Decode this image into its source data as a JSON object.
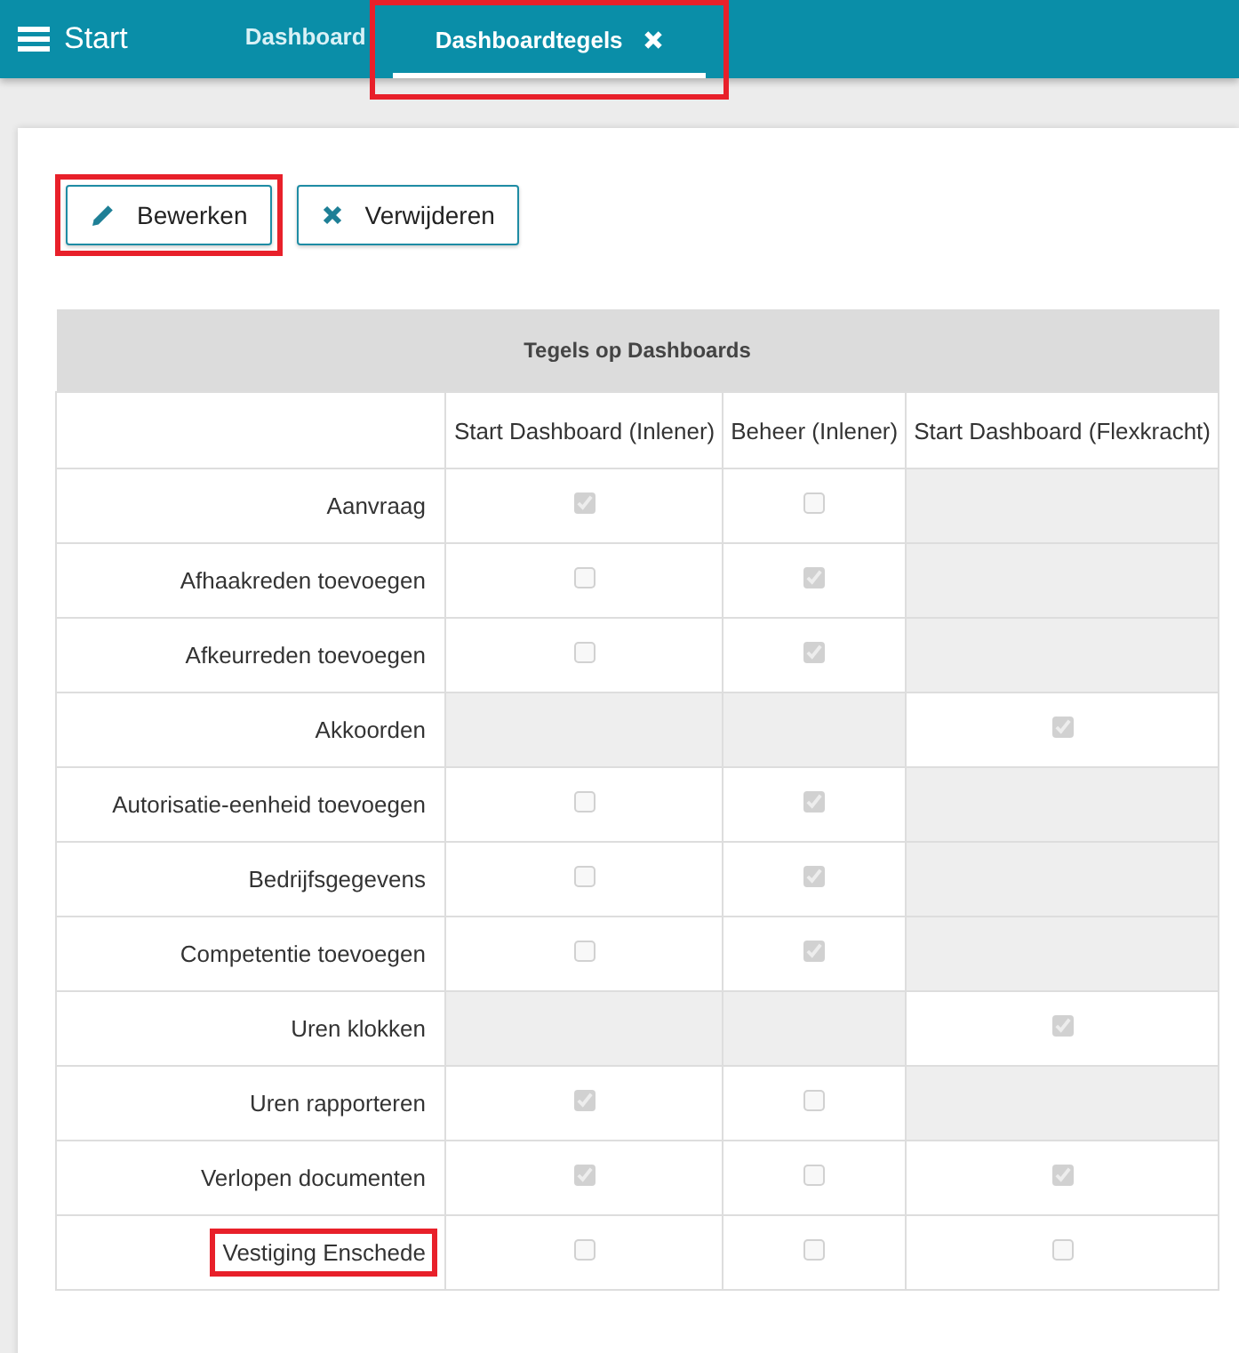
{
  "topbar": {
    "title": "Start"
  },
  "tabs": [
    {
      "label": "Dashboard",
      "selected": false,
      "highlighted": false
    },
    {
      "label": "Dashboardtegels",
      "selected": true,
      "highlighted": true
    }
  ],
  "toolbar": [
    {
      "label": "Bewerken",
      "kind": "edit",
      "highlighted": true
    },
    {
      "label": "Verwijderen",
      "kind": "delete",
      "highlighted": false
    }
  ],
  "table": {
    "title": "Tegels op Dashboards",
    "columns": [
      "Start Dashboard (Inlener)",
      "Beheer (Inlener)",
      "Start Dashboard (Flexkracht)"
    ],
    "rows": [
      {
        "label": "Aanvraag",
        "highlighted": false,
        "cells": [
          {
            "kind": "checkbox",
            "checked": true
          },
          {
            "kind": "checkbox",
            "checked": false
          },
          {
            "kind": "unavailable"
          }
        ]
      },
      {
        "label": "Afhaakreden toevoegen",
        "highlighted": false,
        "cells": [
          {
            "kind": "checkbox",
            "checked": false
          },
          {
            "kind": "checkbox",
            "checked": true
          },
          {
            "kind": "unavailable"
          }
        ]
      },
      {
        "label": "Afkeurreden toevoegen",
        "highlighted": false,
        "cells": [
          {
            "kind": "checkbox",
            "checked": false
          },
          {
            "kind": "checkbox",
            "checked": true
          },
          {
            "kind": "unavailable"
          }
        ]
      },
      {
        "label": "Akkoorden",
        "highlighted": false,
        "cells": [
          {
            "kind": "unavailable"
          },
          {
            "kind": "unavailable"
          },
          {
            "kind": "checkbox",
            "checked": true
          }
        ]
      },
      {
        "label": "Autorisatie-eenheid toevoegen",
        "highlighted": false,
        "cells": [
          {
            "kind": "checkbox",
            "checked": false
          },
          {
            "kind": "checkbox",
            "checked": true
          },
          {
            "kind": "unavailable"
          }
        ]
      },
      {
        "label": "Bedrijfsgegevens",
        "highlighted": false,
        "cells": [
          {
            "kind": "checkbox",
            "checked": false
          },
          {
            "kind": "checkbox",
            "checked": true
          },
          {
            "kind": "unavailable"
          }
        ]
      },
      {
        "label": "Competentie toevoegen",
        "highlighted": false,
        "cells": [
          {
            "kind": "checkbox",
            "checked": false
          },
          {
            "kind": "checkbox",
            "checked": true
          },
          {
            "kind": "unavailable"
          }
        ]
      },
      {
        "label": "Uren klokken",
        "highlighted": false,
        "cells": [
          {
            "kind": "unavailable"
          },
          {
            "kind": "unavailable"
          },
          {
            "kind": "checkbox",
            "checked": true
          }
        ]
      },
      {
        "label": "Uren rapporteren",
        "highlighted": false,
        "cells": [
          {
            "kind": "checkbox",
            "checked": true
          },
          {
            "kind": "checkbox",
            "checked": false
          },
          {
            "kind": "unavailable"
          }
        ]
      },
      {
        "label": "Verlopen documenten",
        "highlighted": false,
        "cells": [
          {
            "kind": "checkbox",
            "checked": true
          },
          {
            "kind": "checkbox",
            "checked": false
          },
          {
            "kind": "checkbox",
            "checked": true
          }
        ]
      },
      {
        "label": "Vestiging Enschede",
        "highlighted": true,
        "cells": [
          {
            "kind": "checkbox",
            "checked": false
          },
          {
            "kind": "checkbox",
            "checked": false
          },
          {
            "kind": "checkbox",
            "checked": false
          }
        ]
      }
    ]
  }
}
